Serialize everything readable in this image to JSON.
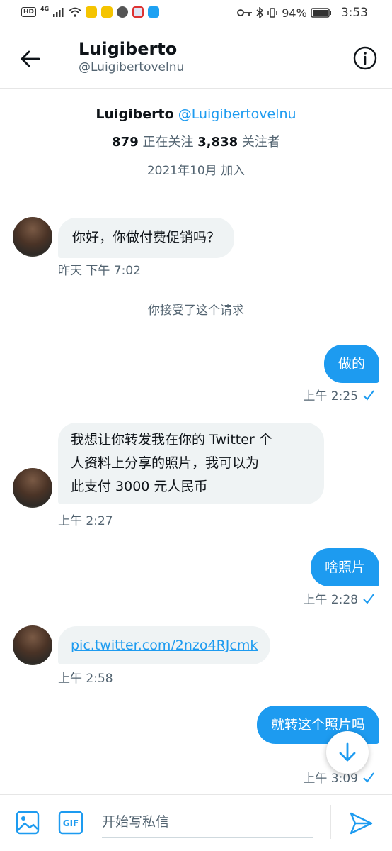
{
  "status_bar": {
    "hd": "HD",
    "network": "4G",
    "battery": "94%",
    "time": "3:53"
  },
  "header": {
    "name": "Luigiberto",
    "handle": "@Luigibertovelnu"
  },
  "profile": {
    "name": "Luigiberto",
    "handle": "@Luigibertovelnu",
    "following_count": "879",
    "following_label": "正在关注",
    "followers_count": "3,838",
    "followers_label": "关注者",
    "joined": "2021年10月 加入"
  },
  "messages": {
    "m1": {
      "text": "你好，你做付费促销吗？",
      "time": "昨天 下午 7:02"
    },
    "system": "你接受了这个请求",
    "m2": {
      "text": "做的",
      "time": "上午 2:25"
    },
    "m3": {
      "text": "我想让你转发我在你的 Twitter 个人资料上分享的照片，我可以为此支付 3000 元人民币",
      "line1": "我想让你转发我在你的 Twitter 个",
      "line2": "人资料上分享的照片，我可以为",
      "line3": "此支付 3000 元人民币",
      "time": "上午 2:27"
    },
    "m4": {
      "text": "啥照片",
      "time": "上午 2:28"
    },
    "m5": {
      "text": "pic.twitter.com/2nzo4RJcmk",
      "time": "上午 2:58"
    },
    "m6": {
      "text": "就转这个照片吗",
      "time": "上午 3:09"
    }
  },
  "composer": {
    "placeholder": "开始写私信",
    "gif_label": "GIF"
  },
  "colors": {
    "accent": "#1d9bf0",
    "incoming_bubble": "#eff3f4",
    "secondary_text": "#536471"
  }
}
